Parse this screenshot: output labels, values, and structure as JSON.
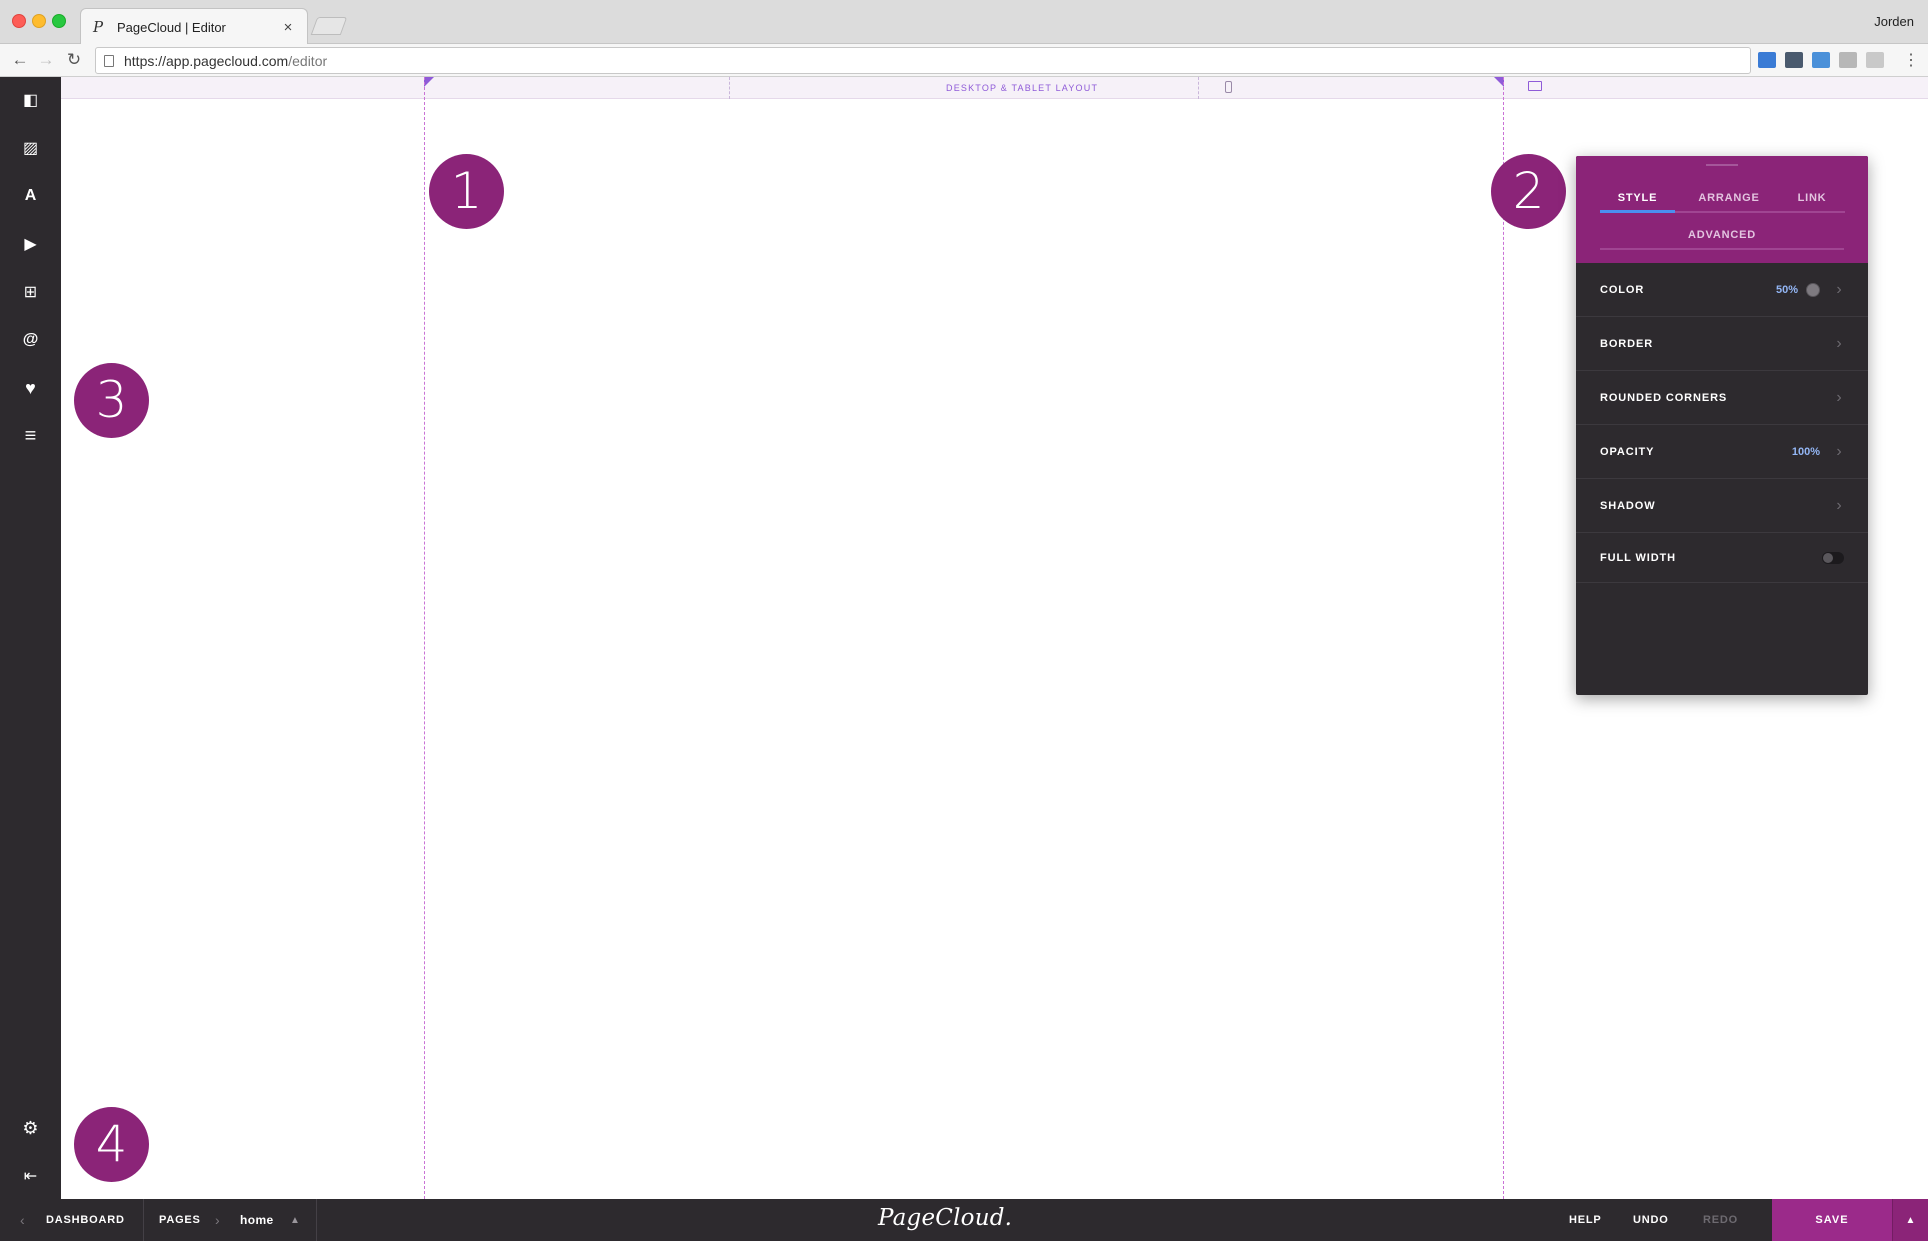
{
  "browser": {
    "tab_title": "PageCloud | Editor",
    "tab_close": "×",
    "user": "Jorden",
    "url_host": "https://app.pagecloud.com",
    "url_path": "/editor",
    "back": "←",
    "forward": "→",
    "reload": "↻",
    "menu": "⋮"
  },
  "layout_bar": {
    "label": "DESKTOP & TABLET LAYOUT"
  },
  "sidebar": {
    "icons": [
      {
        "name": "shapes-icon",
        "glyph": "◧"
      },
      {
        "name": "image-icon",
        "glyph": "▨"
      },
      {
        "name": "text-icon",
        "glyph": "A"
      },
      {
        "name": "video-icon",
        "glyph": "▶"
      },
      {
        "name": "add-widget-icon",
        "glyph": "⊞"
      },
      {
        "name": "at-sign-icon",
        "glyph": "@"
      },
      {
        "name": "heart-icon",
        "glyph": "♥"
      },
      {
        "name": "menu-icon",
        "glyph": "≡"
      }
    ],
    "settings_glyph": "⚙",
    "collapse_glyph": "⇤"
  },
  "badges": [
    "1",
    "2",
    "3",
    "4"
  ],
  "panel": {
    "tabs": {
      "style": "STYLE",
      "arrange": "ARRANGE",
      "link": "LINK",
      "advanced": "ADVANCED"
    },
    "rows": {
      "color": {
        "label": "COLOR",
        "value": "50%"
      },
      "border": {
        "label": "BORDER"
      },
      "rounded_corners": {
        "label": "ROUNDED CORNERS"
      },
      "opacity": {
        "label": "OPACITY",
        "value": "100%"
      },
      "shadow": {
        "label": "SHADOW"
      },
      "full_width": {
        "label": "FULL WIDTH"
      }
    },
    "chevron": "›"
  },
  "bottombar": {
    "back_chevron": "‹",
    "dashboard": "DASHBOARD",
    "pages": "PAGES",
    "page_chevron": "›",
    "current_page": "home",
    "page_caret": "▲",
    "brand": "PageCloud.",
    "help": "HELP",
    "undo": "UNDO",
    "redo": "REDO",
    "save": "SAVE",
    "save_caret": "▲"
  },
  "colors": {
    "brand_purple": "#8b2478",
    "sidebar_dark": "#2d2a2e",
    "active_tab_blue": "#4a8ff0",
    "guide_pink": "#c972d6"
  }
}
